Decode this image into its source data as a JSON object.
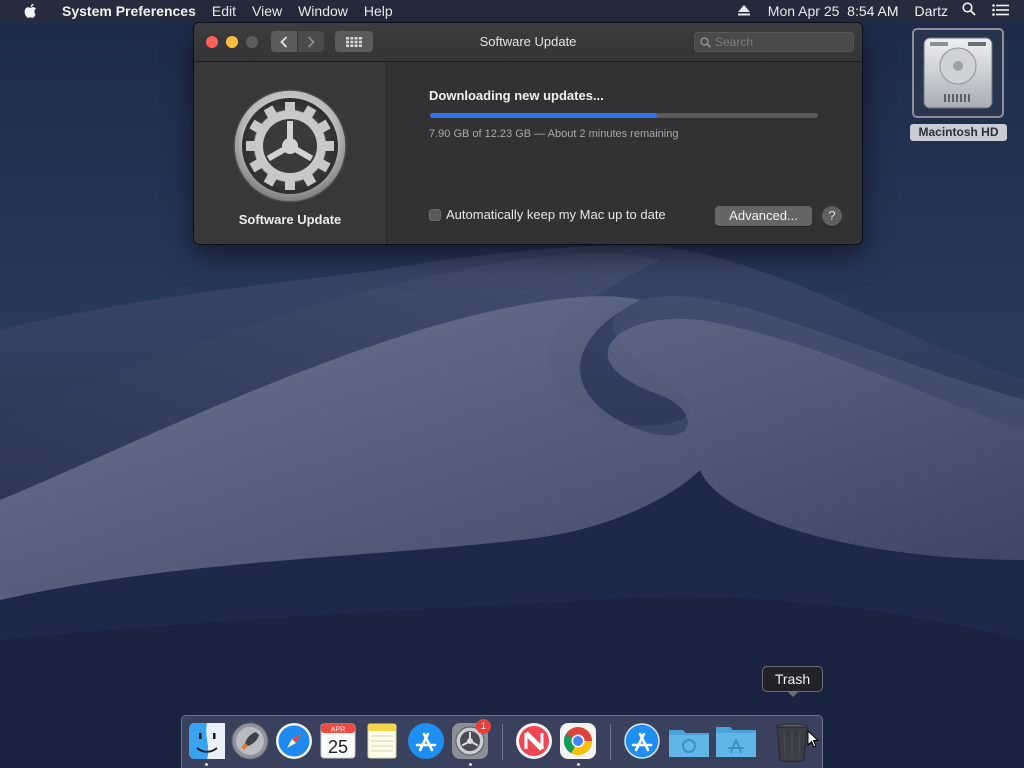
{
  "menubar": {
    "apple": "apple-logo",
    "app_name": "System Preferences",
    "menus": [
      "Edit",
      "View",
      "Window",
      "Help"
    ],
    "status": {
      "eject_icon": "eject-icon",
      "datetime": "Mon Apr 25  8:54 AM",
      "user": "Dartz",
      "spotlight_icon": "search-icon",
      "notification_icon": "list-icon"
    }
  },
  "window": {
    "title": "Software Update",
    "search": {
      "placeholder": "Search",
      "value": ""
    },
    "sidebar_label": "Software Update",
    "status_title": "Downloading new updates...",
    "progress": {
      "fraction": 0.585,
      "text": "7.90 GB of 12.23 GB — About 2 minutes remaining"
    },
    "auto_update": {
      "label": "Automatically keep my Mac up to date",
      "checked": false
    },
    "advanced_button": "Advanced...",
    "help_button": "?"
  },
  "desktop": {
    "disk_label": "Macintosh HD"
  },
  "dock": {
    "tooltip": "Trash",
    "items": [
      {
        "name": "finder-icon",
        "running": true
      },
      {
        "name": "launchpad-icon",
        "running": false
      },
      {
        "name": "safari-icon",
        "running": false
      },
      {
        "name": "calendar-icon",
        "running": false,
        "month": "APR",
        "day": "25"
      },
      {
        "name": "notes-icon",
        "running": false
      },
      {
        "name": "app-store-icon",
        "running": false
      },
      {
        "name": "system-preferences-icon",
        "running": true,
        "badge": "1"
      },
      {
        "name": "news-icon",
        "running": false
      },
      {
        "name": "chrome-icon",
        "running": true
      },
      {
        "name": "app-store-download-icon",
        "running": false
      },
      {
        "name": "downloads-folder-icon",
        "running": false
      },
      {
        "name": "applications-folder-icon",
        "running": false
      },
      {
        "name": "trash-icon",
        "running": false
      }
    ]
  },
  "colors": {
    "accent": "#2f78e8",
    "close": "#fc605b",
    "minimize": "#fdbc40",
    "window_bg": "#323234"
  }
}
